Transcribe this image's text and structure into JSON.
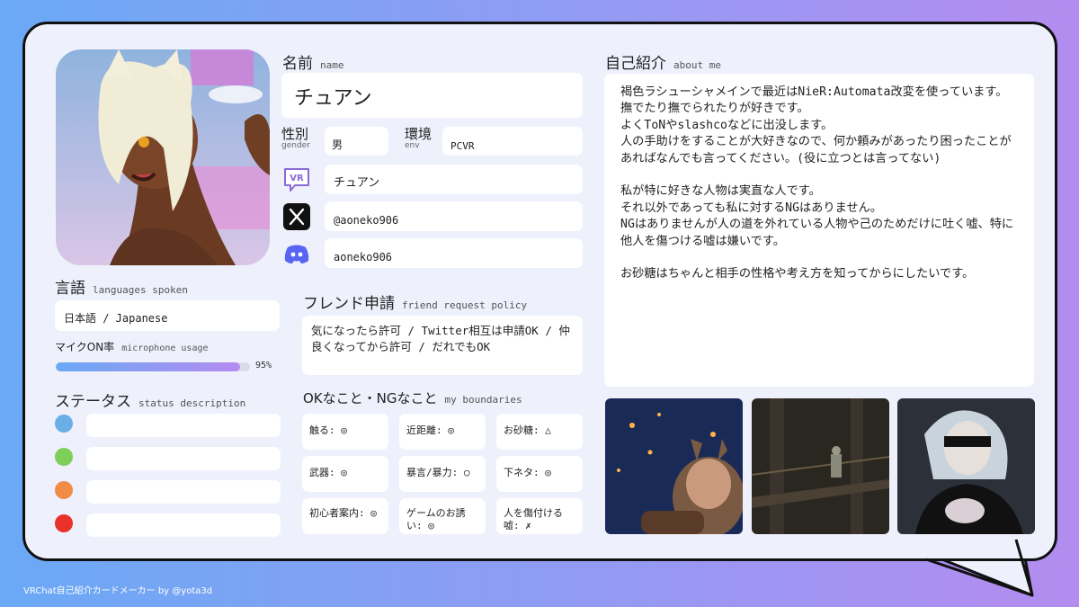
{
  "profile": {
    "name_heading": "名前",
    "name_heading_sub": "name",
    "name": "チュアン",
    "gender_label": "性別",
    "gender_sub": "gender",
    "gender": "男",
    "env_label": "環境",
    "env_sub": "env",
    "env": "PCVR",
    "vrchat_name": "チュアン",
    "x_handle": "@aoneko906",
    "discord_handle": "aoneko906"
  },
  "languages": {
    "heading": "言語",
    "heading_sub": "languages spoken",
    "value": "日本語 / Japanese"
  },
  "microphone": {
    "heading": "マイクON率",
    "heading_sub": "microphone usage",
    "percent_label": "95%",
    "percent": 95
  },
  "status": {
    "heading": "ステータス",
    "heading_sub": "status description",
    "items": [
      {
        "color": "#6aaee8",
        "text": ""
      },
      {
        "color": "#7ecf5a",
        "text": ""
      },
      {
        "color": "#f08c45",
        "text": ""
      },
      {
        "color": "#e8322a",
        "text": ""
      }
    ]
  },
  "friend_request": {
    "heading": "フレンド申請",
    "heading_sub": "friend request policy",
    "text": "気になったら許可 / Twitter相互は申請OK / 仲良くなってから許可 / だれでもOK"
  },
  "boundaries": {
    "heading": "OKなこと・NGなこと",
    "heading_sub": "my boundaries",
    "items": [
      {
        "label": "触る: ◎"
      },
      {
        "label": "近距離: ◎"
      },
      {
        "label": "お砂糖: △"
      },
      {
        "label": "武器: ◎"
      },
      {
        "label": "暴言/暴力: ○"
      },
      {
        "label": "下ネタ: ◎"
      },
      {
        "label": "初心者案内: ◎"
      },
      {
        "label": "ゲームのお誘い: ◎"
      },
      {
        "label": "人を傷付ける嘘: ✗"
      }
    ]
  },
  "about": {
    "heading": "自己紹介",
    "heading_sub": "about me",
    "text": "褐色ラシューシャメインで最近はNieR:Automata改変を使っています。\n撫でたり撫でられたりが好きです。\nよくToNやslashcoなどに出没します。\n人の手助けをすることが大好きなので、何か頼みがあったり困ったことがあればなんでも言ってください。(役に立つとは言ってない)\n\n私が特に好きな人物は実直な人です。\nそれ以外であっても私に対するNGはありません。\nNGはありませんが人の道を外れている人物や己のためだけに吐く嘘、特に他人を傷つける嘘は嫌いです。\n\nお砂糖はちゃんと相手の性格や考え方を知ってからにしたいです。"
  },
  "footer": "VRChat自己紹介カードメーカー by @yota3d",
  "colors": {
    "accent_start": "#6aa9f5",
    "accent_end": "#b48cf0",
    "card_bg": "#eef0fc",
    "discord": "#5865f2"
  },
  "icons": [
    "vrchat-icon",
    "x-icon",
    "discord-icon"
  ]
}
